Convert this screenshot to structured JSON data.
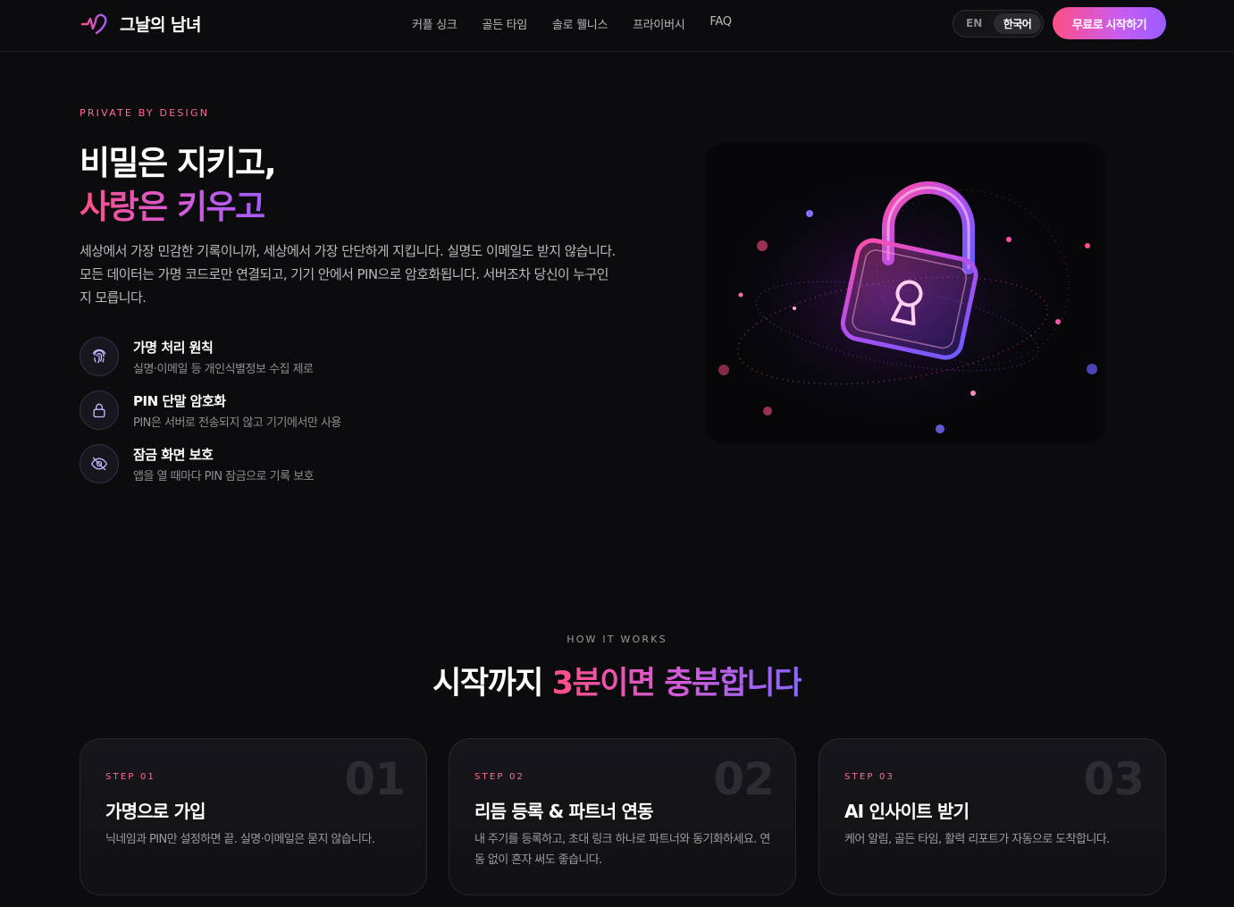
{
  "header": {
    "logo_text": "그날의 남녀",
    "nav": [
      "커플 싱크",
      "골든 타임",
      "솔로 웰니스",
      "프라이버시",
      "FAQ"
    ],
    "lang_en": "EN",
    "lang_ko": "한국어",
    "cta": "무료로 시작하기"
  },
  "hero": {
    "eyebrow": "PRIVATE BY DESIGN",
    "title_line1": "비밀은 지키고,",
    "title_line2": "사랑은 키우고",
    "description": "세상에서 가장 민감한 기록이니까, 세상에서 가장 단단하게 지킵니다. 실명도 이메일도 받지 않습니다. 모든 데이터는 가명 코드로만 연결되고, 기기 안에서 PIN으로 암호화됩니다. 서버조차 당신이 누구인지 모릅니다.",
    "features": [
      {
        "icon": "fingerprint-icon",
        "title": "가명 처리 원칙",
        "subtitle": "실명·이메일 등 개인식별정보 수집 제로"
      },
      {
        "icon": "lock-icon",
        "title": "PIN 단말 암호화",
        "subtitle": "PIN은 서버로 전송되지 않고 기기에서만 사용"
      },
      {
        "icon": "eye-off-icon",
        "title": "잠금 화면 보호",
        "subtitle": "앱을 열 때마다 PIN 잠금으로 기록 보호"
      }
    ],
    "image_icon": "neon-padlock"
  },
  "how_it_works": {
    "eyebrow": "HOW IT WORKS",
    "title_plain": "시작까지 ",
    "title_highlight": "3분이면 충분합니다",
    "steps": [
      {
        "label": "STEP 01",
        "number": "01",
        "title": "가명으로 가입",
        "description": "닉네임과 PIN만 설정하면 끝. 실명·이메일은 묻지 않습니다."
      },
      {
        "label": "STEP 02",
        "number": "02",
        "title": "리듬 등록 & 파트너 연동",
        "description": "내 주기를 등록하고, 초대 링크 하나로 파트너와 동기화하세요. 연동 없이 혼자 써도 좋습니다."
      },
      {
        "label": "STEP 03",
        "number": "03",
        "title": "AI 인사이트 받기",
        "description": "케어 알림, 골든 타임, 활력 리포트가 자동으로 도착합니다."
      }
    ]
  },
  "colors": {
    "background": "#0c0c0e",
    "accent_pink": "#ff4f86",
    "accent_purple": "#a15cff"
  }
}
